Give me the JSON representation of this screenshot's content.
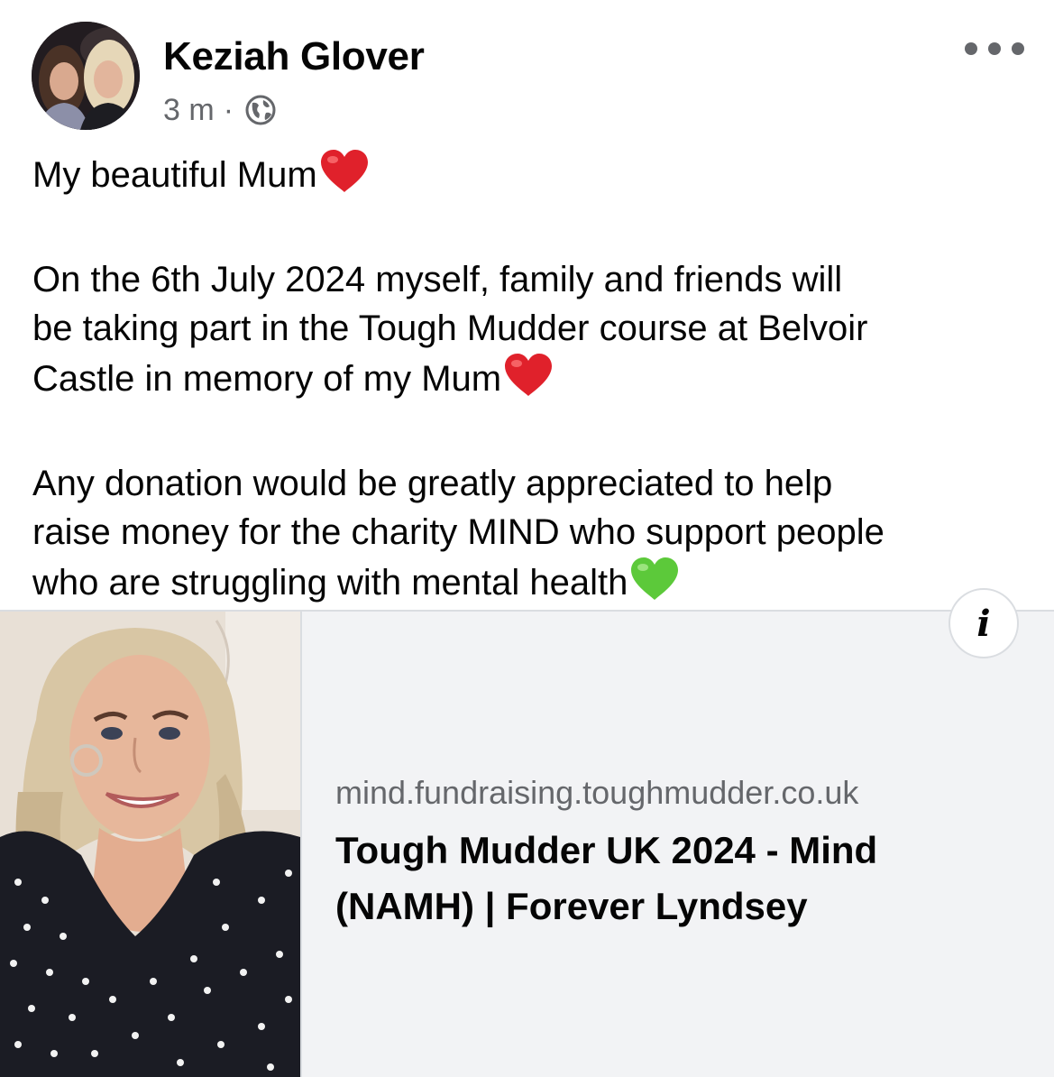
{
  "post": {
    "author": "Keziah Glover",
    "timestamp": "3 m",
    "separator": "·",
    "privacy_icon": "globe-icon",
    "more_icon": "more-options-icon",
    "text_lines": {
      "l1": "My beautiful Mum",
      "l2": "On the 6th July 2024 myself, family and friends will",
      "l3": "be taking part in the Tough Mudder course at Belvoir",
      "l4": "Castle in memory of my Mum",
      "l5": "Any donation would be greatly appreciated to help",
      "l6": "raise money for the charity MIND who support people",
      "l7": "who are struggling with mental health"
    },
    "emojis": [
      "red-heart-icon",
      "red-heart-icon",
      "green-heart-icon"
    ]
  },
  "link_card": {
    "domain": "mind.fundraising.toughmudder.co.uk",
    "title_line1": "Tough Mudder UK 2024 - Mind",
    "title_line2": "(NAMH) | Forever Lyndsey",
    "info_glyph": "i"
  },
  "colors": {
    "text": "#050505",
    "secondary_text": "#65676b",
    "card_background": "#f2f3f5",
    "divider": "#dadde1",
    "red_heart": "#e0212b",
    "green_heart": "#5cc93a"
  }
}
